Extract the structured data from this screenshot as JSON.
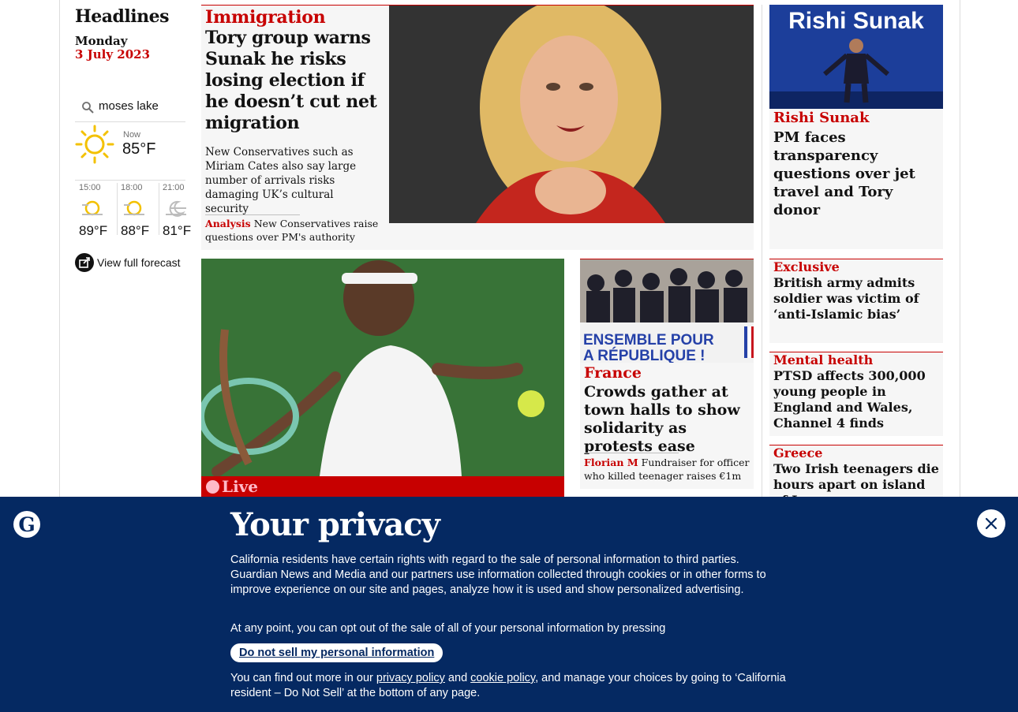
{
  "sidebar": {
    "title": "Headlines",
    "day": "Monday",
    "date": "3 July 2023",
    "weather": {
      "location": "moses lake",
      "now_label": "Now",
      "now_temp": "85°F",
      "forecast": [
        {
          "time": "15:00",
          "temp": "89°F"
        },
        {
          "time": "18:00",
          "temp": "88°F"
        },
        {
          "time": "21:00",
          "temp": "81°F"
        }
      ],
      "full_forecast_link": "View full forecast"
    }
  },
  "stories": {
    "main": {
      "kicker": "Immigration",
      "headline": "Tory group warns Sunak he risks losing election if he doesn’t cut net migration",
      "standfirst": "New Conservatives such as Miriam Cates also say large number of arrivals risks damaging UK’s cultural security",
      "sub_kicker": "Analysis",
      "sub_headline": "New Conservatives raise questions over PM's authority"
    },
    "side_top": {
      "image_text": "Rishi Sunak",
      "kicker": "Rishi Sunak",
      "headline": "PM faces transparency questions over jet travel and Tory donor"
    },
    "live": {
      "label": "Live"
    },
    "france": {
      "image_text_1": "ENSEMBLE POUR",
      "image_text_2": "A RÉPUBLIQUE !",
      "kicker": "France",
      "headline": "Crowds gather at town halls to show solidarity as protests ease",
      "sub_kicker": "Florian M",
      "sub_headline": "Fundraiser for officer who killed teenager raises €1m"
    },
    "small": [
      {
        "kicker": "Exclusive",
        "headline": "British army admits soldier was victim of ‘anti-Islamic bias’"
      },
      {
        "kicker": "Mental health",
        "headline": "PTSD affects 300,000 young people in England and Wales, Channel 4 finds"
      },
      {
        "kicker": "Greece",
        "headline": "Two Irish teenagers die hours apart on island of Ios"
      }
    ]
  },
  "privacy": {
    "title": "Your privacy",
    "paragraph1": "California residents have certain rights with regard to the sale of personal information to third parties. Guardian News and Media and our partners use information collected through cookies or in other forms to improve experience on our site and pages, analyze how it is used and show personalized advertising.",
    "paragraph2": "At any point, you can opt out of the sale of all of your personal information by pressing",
    "button": "Do not sell my personal information",
    "p3_start": "You can find out more in our ",
    "privacy_policy": "privacy policy",
    "and": " and ",
    "cookie_policy": "cookie policy",
    "p3_end": ", and manage your choices by going to ‘California resident – Do Not Sell’ at the bottom of any page."
  },
  "colors": {
    "news_red": "#c70000",
    "brand_blue": "#052962",
    "live_pink": "#ffbac8"
  }
}
